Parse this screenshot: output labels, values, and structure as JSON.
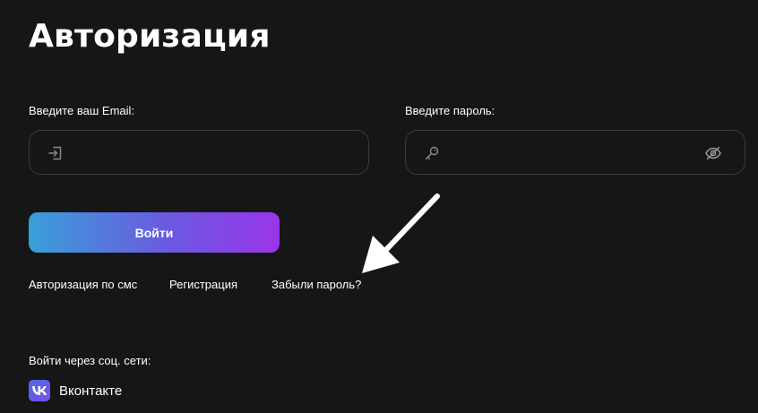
{
  "title": "Авторизация",
  "email": {
    "label": "Введите ваш Email:",
    "value": "",
    "icon": "login-icon"
  },
  "password": {
    "label": "Введите пароль:",
    "value": "",
    "icon": "key-icon",
    "toggle_icon": "eye-off-icon"
  },
  "login_button": "Войти",
  "links": {
    "sms": "Авторизация по смс",
    "register": "Регистрация",
    "forgot": "Забыли пароль?"
  },
  "social": {
    "heading": "Войти через соц. сети:",
    "vk_label": "Вконтакте",
    "vk_icon": "vk-icon"
  },
  "colors": {
    "background": "#161616",
    "button_gradient_start": "#3a9fd8",
    "button_gradient_end": "#9a35ea",
    "field_border": "#3a3a3a"
  }
}
